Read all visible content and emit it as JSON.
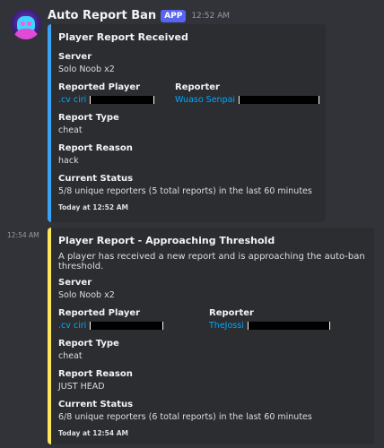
{
  "message": {
    "bot_name": "Auto Report Ban",
    "badge": "APP",
    "timestamp": "12:52 AM"
  },
  "second_message": {
    "timestamp": "12:54 AM"
  },
  "embed1": {
    "accent_color": "#3ba3f5",
    "title": "Player Report Received",
    "server_label": "Server",
    "server_value": "Solo Noob x2",
    "reported_label": "Reported Player",
    "reported_value": ".cv ciri",
    "reporter_label": "Reporter",
    "reporter_value": "Wuaso Senpai",
    "type_label": "Report Type",
    "type_value": "cheat",
    "reason_label": "Report Reason",
    "reason_value": "hack",
    "status_label": "Current Status",
    "status_value": "5/8 unique reporters (5 total reports) in the last 60 minutes",
    "footer": "Today at 12:52 AM"
  },
  "embed2": {
    "accent_color": "#fee75c",
    "title": "Player Report - Approaching Threshold",
    "description": "A player has received a new report and is approaching the auto-ban threshold.",
    "server_label": "Server",
    "server_value": "Solo Noob x2",
    "reported_label": "Reported Player",
    "reported_value": ".cv ciri",
    "reporter_label": "Reporter",
    "reporter_value": "TheJossi",
    "type_label": "Report Type",
    "type_value": "cheat",
    "reason_label": "Report Reason",
    "reason_value": "JUST HEAD",
    "status_label": "Current Status",
    "status_value": "6/8 unique reporters (6 total reports) in the last 60 minutes",
    "footer": "Today at 12:54 AM"
  }
}
